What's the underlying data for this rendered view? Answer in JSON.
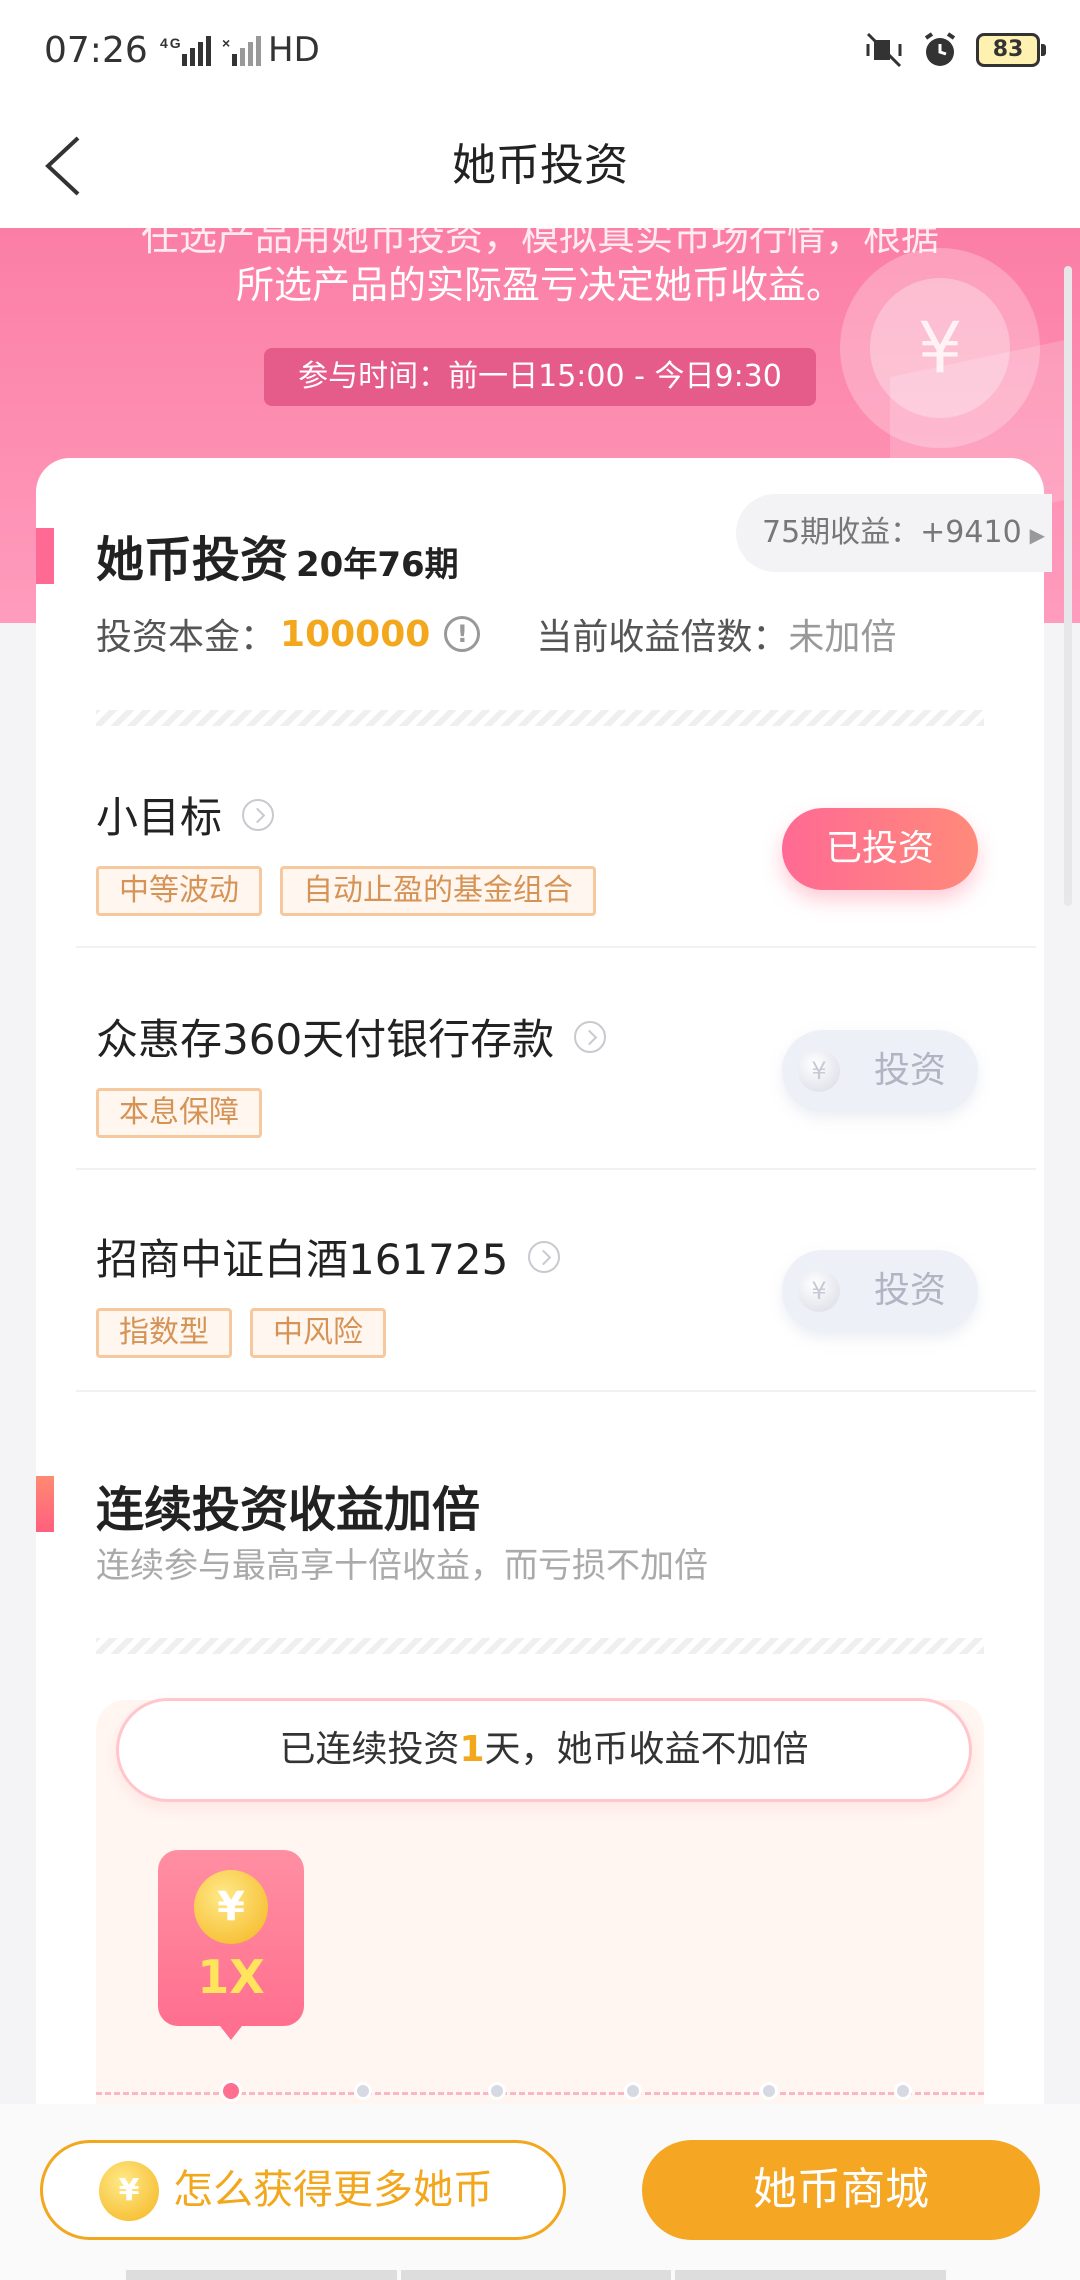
{
  "status_bar": {
    "time": "07:26",
    "signal": "4G HD",
    "battery": "83"
  },
  "header": {
    "title": "她币投资"
  },
  "banner": {
    "line1": "任选产品用她币投资，模拟真实市场行情，根据",
    "line2": "所选产品的实际盈亏决定她币收益。",
    "time_pill": "参与时间：前一日15:00 - 今日9:30"
  },
  "investment": {
    "title": "她币投资",
    "period": "20年76期",
    "prev_earnings": "75期收益：+9410",
    "principal_label": "投资本金：",
    "principal_value": "100000",
    "multiplier_label": "当前收益倍数：",
    "multiplier_value": "未加倍"
  },
  "products": [
    {
      "name": "小目标",
      "tags": [
        "中等波动",
        "自动止盈的基金组合"
      ],
      "button": "已投资"
    },
    {
      "name": "众惠存360天付银行存款",
      "tags": [
        "本息保障"
      ],
      "button": "投资"
    },
    {
      "name": "招商中证白酒161725",
      "tags": [
        "指数型",
        "中风险"
      ],
      "button": "投资"
    }
  ],
  "streak": {
    "title": "连续投资收益加倍",
    "desc": "连续参与最高享十倍收益，而亏损不加倍",
    "bubble_prefix": "已连续投资",
    "bubble_days": "1",
    "bubble_suffix": "天，她币收益不加倍",
    "multiplier": "1X"
  },
  "bottom": {
    "earn_button": "怎么获得更多她币",
    "mall_button": "她币商城"
  },
  "icons": {
    "yen": "¥",
    "warning": "!"
  }
}
